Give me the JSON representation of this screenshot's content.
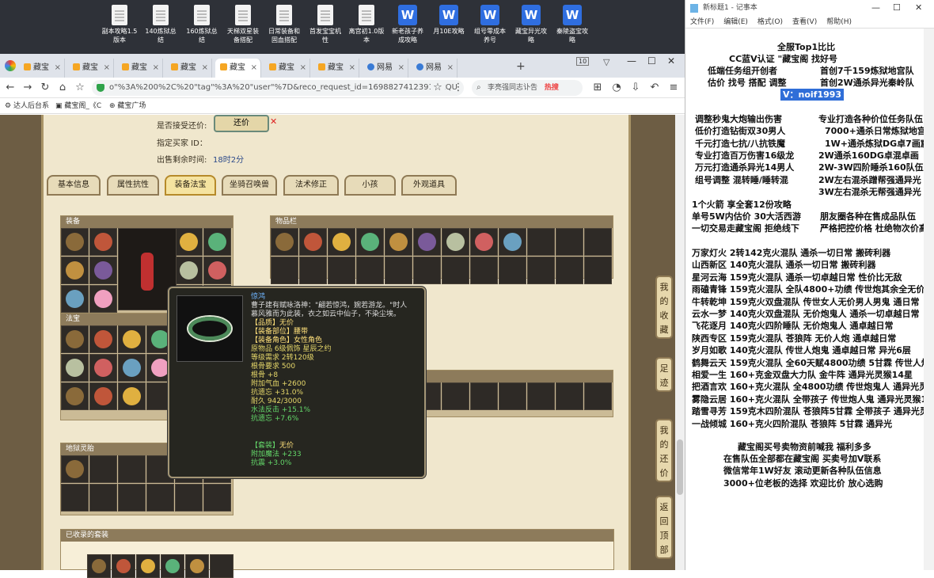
{
  "desktop": {
    "icons": [
      {
        "type": "doc",
        "label": "副本攻略1.5版本"
      },
      {
        "type": "doc",
        "label": "140炼狱总结"
      },
      {
        "type": "doc",
        "label": "160炼狱总结"
      },
      {
        "type": "doc",
        "label": "天梯双星装备搭配"
      },
      {
        "type": "doc",
        "label": "日常装备和固血搭配"
      },
      {
        "type": "doc",
        "label": "首发宝宝机性"
      },
      {
        "type": "doc",
        "label": "离宫初1.0版本"
      },
      {
        "type": "wps",
        "label": "新老孩子养成攻略"
      },
      {
        "type": "wps",
        "label": "月10E攻略"
      },
      {
        "type": "wps",
        "label": "组号零成本养号"
      },
      {
        "type": "wps",
        "label": "藏宝异光攻略"
      },
      {
        "type": "wps",
        "label": "秦陵盗宝攻略"
      }
    ]
  },
  "browser": {
    "tabs": [
      "藏宝",
      "藏宝",
      "藏宝",
      "藏宝",
      "藏宝",
      "藏宝",
      "藏宝",
      "网易",
      "网易"
    ],
    "tab_count": "10",
    "url": "o\"%3A%200%2C%20\"tag\"%3A%20\"user\"%7D&reco_request_id=16988274123910lkQU",
    "search_text": "李亮强同志讣告",
    "hot_label": "热搜",
    "bookmarks": [
      "达人后台系",
      "藏宝阁_《C",
      "藏宝广场"
    ]
  },
  "game": {
    "return_label": "是否接受还价:",
    "return_button": "还价",
    "buyer_label": "指定买家 ID：",
    "buyer_value": "",
    "time_label": "出售剩余时间:",
    "time_value": "18时2分",
    "tabs": [
      "基本信息",
      "属性抗性",
      "装备法宝",
      "坐骑召唤兽",
      "法术修正",
      "小孩",
      "外观道具"
    ],
    "active_tab": "装备法宝",
    "sections": {
      "equip": "装备",
      "inventory": "物品栏",
      "fabao": "法宝",
      "dilao": "地狱灵胎",
      "suits": "已收录的套装"
    },
    "side_buttons": [
      "我的收藏",
      "足迹",
      "我的还价",
      "返回顶部"
    ],
    "tooltip": {
      "name": "惊鸿",
      "desc1": "曹子建有赋咏洛神：\"翩若惊鸿，婉若游龙。\"时人",
      "desc2": "慕风雅而为此装，衣之如云中仙子，不染尘埃。",
      "quality": "【品质】无价",
      "slot": "【装备部位】腰带",
      "role": "【装备角色】女性角色",
      "material": "原物品 6级佩饰 星辰之约",
      "level": "等级需求 2转120级",
      "root_req": "根骨要求 500",
      "root": "根骨 +8",
      "hp": "附加气血 +2600",
      "resist1": "抗遗忘 +31.0%",
      "durability": "耐久 942/3000",
      "water": "水法反击 +15.1%",
      "resist2": "抗遗忘 +7.6%",
      "suit_label": "【套装】",
      "suit_value": "无价",
      "magic": "附加魔法 +233",
      "seal": "抗震 +3.0%"
    }
  },
  "notepad": {
    "title": "新标题1 - 记事本",
    "menu": [
      "文件(F)",
      "编辑(E)",
      "格式(O)",
      "查看(V)",
      "帮助(H)"
    ],
    "header": [
      "全服Top1比比",
      "CC蓝V认证 \"藏宝阁 找好号",
      "低端任务组开创者",
      "首创7千159炼狱地宫队",
      "估价 找号 搭配 调整",
      "首创2W通杀异光秦岭队"
    ],
    "vid": "V：noif1993",
    "left_lines": [
      "调整秒鬼大炮输出伤害",
      "低价打造钻街双30男人",
      "千元打造七抗/八抗铁魔",
      "专业打造百万伤害16级龙",
      "万元打造通杀异光14男人",
      "组号调整 混转睡/睡转混"
    ],
    "right_lines": [
      "专业打造各种价位任务队伍",
      "7000+通杀日常炼狱地宫",
      "1W+通杀炼狱DG卓7画窟",
      "2W通杀160DG卓混卓画",
      "2W-3W四阶睡杀160队伍",
      "2W左右混杀蹭帮强通异光",
      "3W左右混杀无帮强通异光"
    ],
    "mid_lines": [
      "1个火箭 享全套12份攻略",
      "单号5W内估价 30大活西游",
      "一切交易走藏宝阁 拒绝线下"
    ],
    "mid_right": [
      "朋友圈各种在售成品队伍",
      "严格把控价格 杜绝物次价高"
    ],
    "servers": [
      "万家灯火 2转142克火混队 通杀一切日常 搬砖利器",
      "山西新区 140克火混队 通杀一切日常 搬砖利器",
      "星河云海 159克火混队 通杀一切卓越日常 性价比无敌",
      "雨磕青锋 159克火混队 全队4800+功绩 传世炮其余全无价",
      "牛转乾坤 159克火双盘混队 传世女人无价男人男鬼 通日常",
      "云水一梦 140克火双盘混队 无价炮鬼人 通杀一切卓越日常",
      "飞花逐月 140克火四阶睡队 无价炮鬼人 通卓越日常",
      "陕西专区 159克火混队 苍狼阵 无价人炮 通卓越日常",
      "岁月如歌 140克火混队 传世人炮鬼 通卓越日常 异光6层",
      "鹤舞云天 159克火混队 全60天赋4800功绩 5甘霖 传世人炮",
      "相爱一生 160+克金双盘大力队 金牛阵 通异光灵猴14星",
      "把酒言欢 160+克火混队 全4800功绩 传世炮鬼人 通异光灵猴",
      "雾隐云居 160+克火混队 全带孩子 传世炮人鬼 通异光灵猴14",
      "踏雪寻芳 159克木四阶混队 苍狼阵5甘霖 全带孩子 通异光灵猴",
      "一战倾城 160+克火四阶混队 苍狼阵 5甘霖 通异光"
    ],
    "footer": [
      "藏宝阁买号卖物资前喊我 福利多多",
      "在售队伍全部都在藏宝阁 买卖号加V联系",
      "微信常年1W好友 滚动更新各种队伍信息",
      "3000+位老板的选择 欢迎比价 放心选购"
    ]
  }
}
